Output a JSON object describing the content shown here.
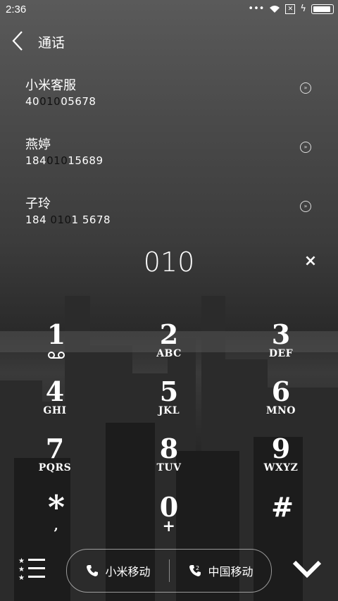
{
  "status": {
    "time": "2:36",
    "sim_slot": "✕"
  },
  "header": {
    "title": "通话"
  },
  "contacts": [
    {
      "name": "小米客服",
      "num_pre": "40",
      "num_hl": "010",
      "num_post": "05678"
    },
    {
      "name": "燕婷",
      "num_pre": "184",
      "num_hl": "010",
      "num_post": "15689"
    },
    {
      "name": "子玲",
      "num_pre": "184 ",
      "num_hl": "010",
      "num_post": "1 5678"
    }
  ],
  "dialer": {
    "input": "010",
    "delete_label": "×",
    "keys": [
      {
        "digit": "1",
        "letters": ""
      },
      {
        "digit": "2",
        "letters": "ABC"
      },
      {
        "digit": "3",
        "letters": "DEF"
      },
      {
        "digit": "4",
        "letters": "GHI"
      },
      {
        "digit": "5",
        "letters": "JKL"
      },
      {
        "digit": "6",
        "letters": "MNO"
      },
      {
        "digit": "7",
        "letters": "PQRS"
      },
      {
        "digit": "8",
        "letters": "TUV"
      },
      {
        "digit": "9",
        "letters": "WXYZ"
      },
      {
        "digit": "*",
        "letters": ","
      },
      {
        "digit": "0",
        "letters": "+"
      },
      {
        "digit": "#",
        "letters": ""
      }
    ]
  },
  "call_buttons": {
    "sim1_label": "小米移动",
    "sim2_label": "中国移动"
  }
}
